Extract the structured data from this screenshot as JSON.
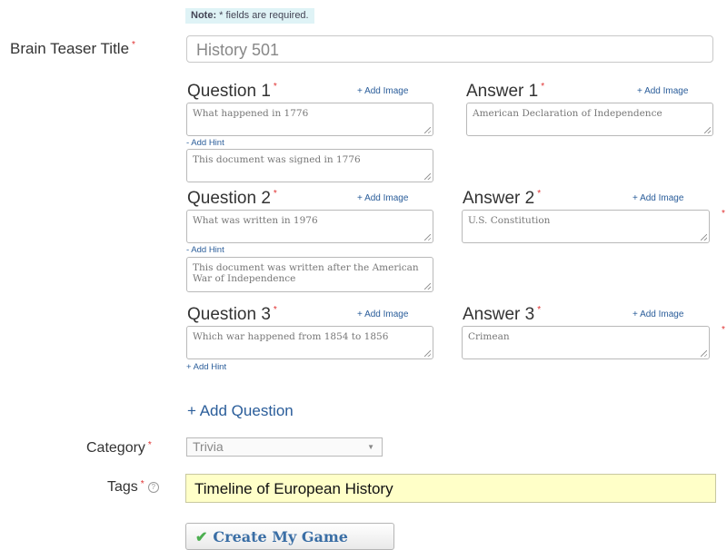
{
  "note": {
    "bold": "Note:",
    "text": " * fields are required."
  },
  "title": {
    "label": "Brain Teaser Title",
    "value": "History 501"
  },
  "add_image": "+ Add Image",
  "add_hint": "+ Add Hint",
  "remove_hint": "- Add Hint",
  "required_mark": "*",
  "questions": [
    {
      "q_label": "Question 1",
      "a_label": "Answer 1",
      "question": "What happened in 1776",
      "answer": "American Declaration of Independence",
      "hint": "This document was signed in 1776"
    },
    {
      "q_label": "Question 2",
      "a_label": "Answer 2",
      "question": "What was written in 1976",
      "answer": "U.S. Constitution",
      "hint": " This document was written after the American War of Independence"
    },
    {
      "q_label": "Question 3",
      "a_label": "Answer 3",
      "question": "Which war happened from 1854 to 1856",
      "answer": "Crimean"
    }
  ],
  "add_question": "+ Add Question",
  "category": {
    "label": "Category",
    "value": "Trivia"
  },
  "tags": {
    "label": "Tags",
    "value": "Timeline of European History"
  },
  "create_button": "Create My Game"
}
